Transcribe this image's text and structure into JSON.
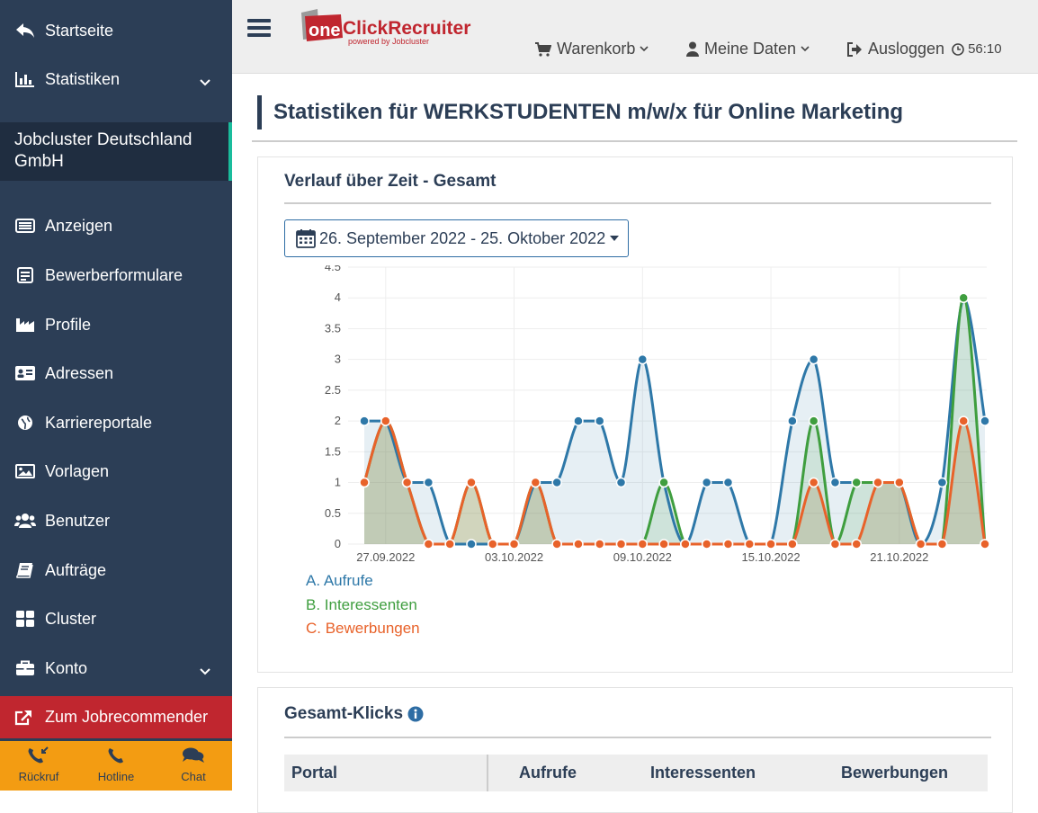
{
  "sidebar": {
    "items": [
      {
        "label": "Startseite",
        "icon": "reply-icon"
      },
      {
        "label": "Statistiken",
        "icon": "bar-chart-icon"
      },
      {
        "label": "Anzeigen",
        "icon": "list-icon"
      },
      {
        "label": "Bewerberformulare",
        "icon": "form-icon"
      },
      {
        "label": "Profile",
        "icon": "industry-icon"
      },
      {
        "label": "Adressen",
        "icon": "address-card-icon"
      },
      {
        "label": "Karriereportale",
        "icon": "globe-icon"
      },
      {
        "label": "Vorlagen",
        "icon": "image-icon"
      },
      {
        "label": "Benutzer",
        "icon": "users-icon"
      },
      {
        "label": "Aufträge",
        "icon": "book-icon"
      },
      {
        "label": "Cluster",
        "icon": "grid-icon"
      },
      {
        "label": "Konto",
        "icon": "briefcase-icon"
      }
    ],
    "company": "Jobcluster Deutschland GmbH",
    "jobrecommender": "Zum Jobrecommender",
    "contact": {
      "callback": "Rückruf",
      "hotline": "Hotline",
      "chat": "Chat"
    }
  },
  "topbar": {
    "logo_one": "one",
    "logo_main": "ClickRecruiter",
    "logo_sub": "powered by Jobcluster",
    "cart": "Warenkorb",
    "mydata": "Meine Daten",
    "logout": "Ausloggen",
    "timer": "56:10"
  },
  "page": {
    "title": "Statistiken für WERKSTUDENTEN m/w/x für Online Marketing",
    "card1_title": "Verlauf über Zeit - Gesamt",
    "date_range": "26. September 2022 - 25. Oktober 2022",
    "card2_title": "Gesamt-Klicks"
  },
  "table": {
    "headers": [
      "Portal",
      "Aufrufe",
      "Interessenten",
      "Bewerbungen"
    ]
  },
  "colors": {
    "sidebar": "#2c3e56",
    "accent": "#1abc9c",
    "jobrec": "#c0262f",
    "contact": "#f39c12",
    "aufrufe": "#2e78a8",
    "interessenten": "#3f9e3f",
    "bewerbungen": "#e8622a"
  },
  "chart_data": {
    "type": "area",
    "x": [
      "26.09",
      "27.09",
      "28.09",
      "29.09",
      "30.09",
      "01.10",
      "02.10",
      "03.10",
      "04.10",
      "05.10",
      "06.10",
      "07.10",
      "08.10",
      "09.10",
      "10.10",
      "11.10",
      "12.10",
      "13.10",
      "14.10",
      "15.10",
      "16.10",
      "17.10",
      "18.10",
      "19.10",
      "20.10",
      "21.10",
      "22.10",
      "23.10",
      "24.10",
      "25.10"
    ],
    "x_tick_labels": [
      "27.09.2022",
      "03.10.2022",
      "09.10.2022",
      "15.10.2022",
      "21.10.2022"
    ],
    "y_ticks": [
      "0",
      "0.5",
      "1",
      "1.5",
      "2",
      "2.5",
      "3",
      "3.5",
      "4",
      "4.5"
    ],
    "ylim": [
      0,
      4.5
    ],
    "series": [
      {
        "name": "A. Aufrufe",
        "values": [
          2,
          2,
          1,
          1,
          0,
          0,
          0,
          0,
          1,
          1,
          2,
          2,
          1,
          3,
          1,
          0,
          1,
          1,
          0,
          0,
          2,
          3,
          1,
          1,
          1,
          1,
          0,
          1,
          4,
          2
        ]
      },
      {
        "name": "B. Interessenten",
        "values": [
          1,
          2,
          1,
          0,
          0,
          1,
          0,
          0,
          1,
          0,
          0,
          0,
          0,
          0,
          1,
          0,
          0,
          0,
          0,
          0,
          0,
          2,
          0,
          1,
          1,
          1,
          0,
          0,
          4,
          0
        ]
      },
      {
        "name": "C. Bewerbungen",
        "values": [
          1,
          2,
          1,
          0,
          0,
          1,
          0,
          0,
          1,
          0,
          0,
          0,
          0,
          0,
          0,
          0,
          0,
          0,
          0,
          0,
          0,
          1,
          0,
          0,
          1,
          1,
          0,
          0,
          2,
          0
        ]
      }
    ]
  }
}
